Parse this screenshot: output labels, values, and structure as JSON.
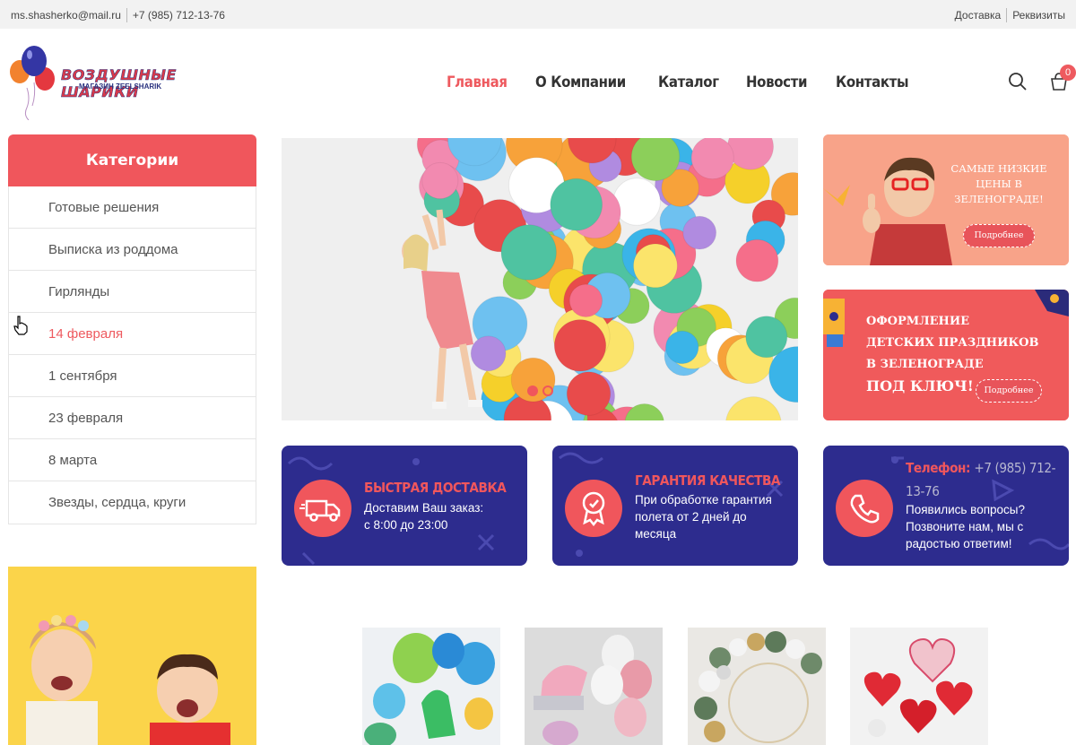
{
  "topbar": {
    "email": "ms.shasherko@mail.ru",
    "phone": "+7 (985) 712-13-76",
    "delivery": "Доставка",
    "requisites": "Реквизиты"
  },
  "logo": {
    "title": "ВОЗДУШНЫЕ ШАРИКИ",
    "subtitle": "МАГАЗИН ZEELSHARIK"
  },
  "nav": {
    "items": [
      "Главная",
      "О Компании",
      "Каталог",
      "Новости",
      "Контакты"
    ],
    "active_color": "#ee5a5f"
  },
  "header_icons": {
    "search": "search-icon",
    "cart": "cart-icon",
    "cart_count": "0"
  },
  "sidebar": {
    "title": "Категории",
    "items": [
      "Готовые решения",
      "Выписка из роддома",
      "Гирлянды",
      "14 февраля",
      "1 сентября",
      "23 февраля",
      "8 марта",
      "Звезды, сердца, круги"
    ],
    "active_index": 3
  },
  "promo1": {
    "line1": "САМЫЕ НИЗКИЕ",
    "line2": "ЦЕНЫ В",
    "line3": "ЗЕЛЕНОГРАДЕ!",
    "button": "Подробнее"
  },
  "promo2": {
    "line1": "ОФОРМЛЕНИЕ",
    "line2": "ДЕТСКИХ ПРАЗДНИКОВ",
    "line3": "В ЗЕЛЕНОГРАДЕ",
    "line4": "ПОД КЛЮЧ!",
    "button": "Подробнее"
  },
  "info": {
    "delivery": {
      "title": "БЫСТРАЯ ДОСТАВКА",
      "text1": "Доставим Ваш заказ:",
      "text2": "с 8:00 до 23:00",
      "icon": "truck-icon"
    },
    "quality": {
      "title": "ГАРАНТИЯ КАЧЕСТВА",
      "text1": "При обработке гарантия",
      "text2": "полета от 2 дней до",
      "text3": "месяца",
      "icon": "badge-icon"
    },
    "phone": {
      "label": "Телефон:",
      "number1": "+7 (985) 712-",
      "number2": "13-76",
      "text1": "Появились вопросы?",
      "text2": "Позвоните нам, мы с",
      "text3": "радостью ответим!",
      "icon": "phone-icon"
    }
  },
  "colors": {
    "accent": "#f0565c",
    "navy": "#2d2c8e",
    "topbar": "#f2f2f2"
  }
}
